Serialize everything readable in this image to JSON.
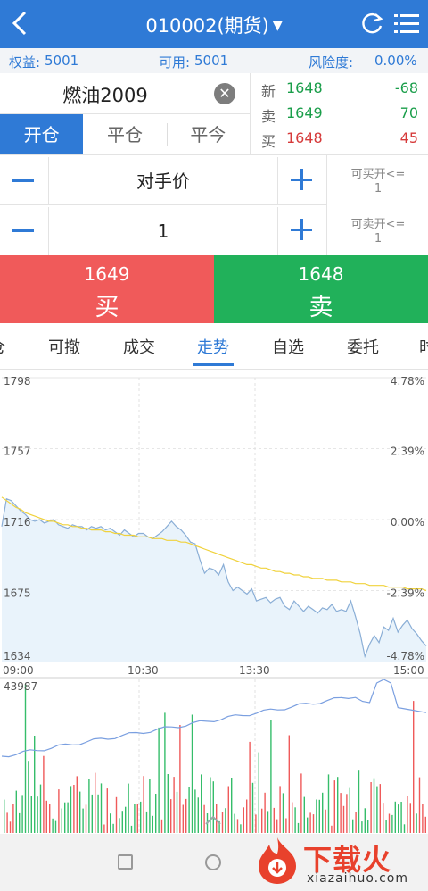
{
  "header": {
    "title": "010002(期货)",
    "back_icon": "chevron-left-icon",
    "refresh_icon": "refresh-icon",
    "menu_icon": "menu-icon"
  },
  "account": {
    "equity_label": "权益:",
    "equity_value": "5001",
    "available_label": "可用:",
    "available_value": "5001",
    "risk_label": "风险度:",
    "risk_value": "0.00%"
  },
  "contract": {
    "name": "燃油2009"
  },
  "order_tabs": [
    "开仓",
    "平仓",
    "平今"
  ],
  "quotes": [
    {
      "label": "新",
      "price": "1648",
      "change": "-68",
      "color": "#1a9e4a"
    },
    {
      "label": "卖",
      "price": "1649",
      "change": "70",
      "color": "#1a9e4a"
    },
    {
      "label": "买",
      "price": "1648",
      "change": "45",
      "color": "#d63a3a"
    }
  ],
  "price_field": {
    "value": "对手价"
  },
  "qty_field": {
    "value": "1"
  },
  "availability": {
    "buy_label": "可买开<=",
    "buy_value": "1",
    "sell_label": "可卖开<=",
    "sell_value": "1"
  },
  "buy": {
    "price": "1649",
    "label": "买"
  },
  "sell": {
    "price": "1648",
    "label": "卖"
  },
  "nav_tabs": [
    "仓",
    "可撤",
    "成交",
    "走势",
    "自选",
    "委托",
    "时"
  ],
  "chart_data": {
    "type": "line",
    "y_ticks": [
      "1798",
      "1757",
      "1716",
      "1675",
      "1634"
    ],
    "pct_ticks": [
      "4.78%",
      "2.39%",
      "0.00%",
      "-2.39%",
      "-4.78%"
    ],
    "x_ticks": [
      "09:00",
      "10:30",
      "13:30",
      "15:00"
    ],
    "ylim": [
      1634,
      1798
    ],
    "volume_max": "43987",
    "series": [
      {
        "values": [
          1712,
          1728,
          1727,
          1724,
          1721,
          1719,
          1716,
          1715,
          1716,
          1714,
          1715,
          1716,
          1713,
          1712,
          1711,
          1713,
          1712,
          1712,
          1710,
          1712,
          1711,
          1712,
          1710,
          1711,
          1709,
          1707,
          1710,
          1708,
          1706,
          1708,
          1708,
          1706,
          1705,
          1707,
          1709,
          1712,
          1715,
          1712,
          1710,
          1707,
          1703,
          1702,
          1693,
          1685,
          1688,
          1687,
          1684,
          1690,
          1680,
          1675,
          1677,
          1675,
          1673,
          1676,
          1669,
          1670,
          1671,
          1668,
          1670,
          1671,
          1666,
          1664,
          1669,
          1666,
          1663,
          1666,
          1664,
          1662,
          1665,
          1664,
          1667,
          1663,
          1664,
          1663,
          1669,
          1660,
          1650,
          1637,
          1644,
          1649,
          1645,
          1654,
          1652,
          1659,
          1651,
          1655,
          1658,
          1653,
          1650,
          1646,
          1643
        ]
      },
      {
        "values": [
          1729,
          1727,
          1725,
          1723,
          1722,
          1720,
          1719,
          1718,
          1717,
          1716,
          1715,
          1715,
          1714,
          1713,
          1713,
          1712,
          1712,
          1711,
          1711,
          1710,
          1710,
          1710,
          1709,
          1709,
          1708,
          1708,
          1707,
          1707,
          1707,
          1706,
          1706,
          1706,
          1705,
          1705,
          1705,
          1704,
          1704,
          1704,
          1703,
          1703,
          1702,
          1701,
          1700,
          1699,
          1698,
          1697,
          1696,
          1695,
          1694,
          1693,
          1692,
          1691,
          1690,
          1690,
          1689,
          1688,
          1688,
          1687,
          1686,
          1686,
          1685,
          1685,
          1684,
          1684,
          1683,
          1683,
          1682,
          1682,
          1682,
          1681,
          1681,
          1681,
          1680,
          1680,
          1680,
          1679,
          1679,
          1679,
          1678,
          1678,
          1678,
          1678,
          1677,
          1677,
          1677,
          1677,
          1676,
          1676,
          1676,
          1676,
          1675
        ]
      }
    ],
    "colors": {
      "price": "#8aaed6",
      "average": "#f0d23c",
      "fill": "#e9f3fb",
      "volume_up": "#ef5a5a",
      "volume_down": "#35bd6a"
    }
  },
  "watermark": {
    "cn": "下载火",
    "en": "xiazaihuo.com"
  }
}
